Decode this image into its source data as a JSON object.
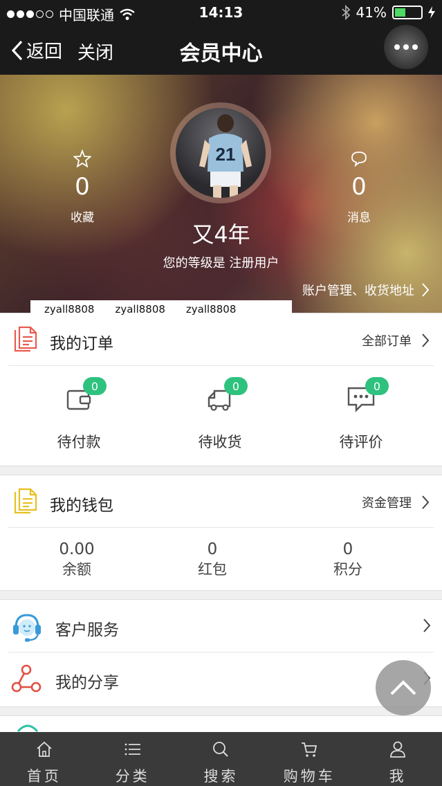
{
  "status_bar": {
    "carrier": "中国联通",
    "time": "14:13",
    "battery": "41%",
    "battery_level": 0.41,
    "signal_dots_filled": 3,
    "signal_dots_total": 5
  },
  "nav": {
    "back_label": "返回",
    "close_label": "关闭",
    "title": "会员中心"
  },
  "profile": {
    "favorites": {
      "count": "0",
      "label": "收藏"
    },
    "messages": {
      "count": "0",
      "label": "消息"
    },
    "username": "又4年",
    "level_text": "您的等级是 注册用户",
    "account_link": "账户管理、收货地址",
    "jersey_number": "21"
  },
  "watermark": [
    "zyall8808",
    "zyall8808",
    "zyall8808"
  ],
  "orders": {
    "title": "我的订单",
    "link": "全部订单",
    "items": [
      {
        "label": "待付款",
        "badge": "0",
        "icon": "wallet-icon"
      },
      {
        "label": "待收货",
        "badge": "0",
        "icon": "truck-icon"
      },
      {
        "label": "待评价",
        "badge": "0",
        "icon": "comment-icon"
      }
    ]
  },
  "wallet": {
    "title": "我的钱包",
    "link": "资金管理",
    "items": [
      {
        "value": "0.00",
        "label": "余额"
      },
      {
        "value": "0",
        "label": "红包"
      },
      {
        "value": "0",
        "label": "积分"
      }
    ]
  },
  "services": {
    "items": [
      {
        "label": "客户服务",
        "icon": "headset-icon"
      },
      {
        "label": "我的分享",
        "icon": "share-icon"
      }
    ]
  },
  "tabbar": {
    "items": [
      {
        "label": "首页",
        "icon": "home-icon"
      },
      {
        "label": "分类",
        "icon": "list-icon"
      },
      {
        "label": "搜索",
        "icon": "search-icon"
      },
      {
        "label": "购物车",
        "icon": "cart-icon"
      },
      {
        "label": "我",
        "icon": "user-icon"
      }
    ]
  },
  "colors": {
    "badge": "#2ec27e",
    "order_icon_red": "#e85a4f",
    "wallet_icon_yellow": "#e8c020",
    "service_icon_blue": "#3a9ad8",
    "share_icon_red": "#e05040",
    "topbar": "#1a1a1a",
    "tabbar": "#3a3a3a"
  }
}
